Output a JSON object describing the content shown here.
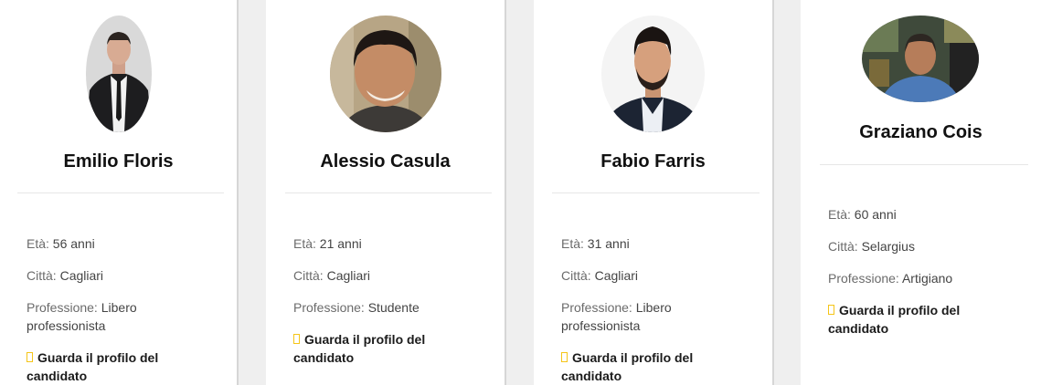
{
  "labels": {
    "age": "Età:",
    "city": "Città:",
    "profession": "Professione:",
    "cta": "Guarda il profilo del candidato"
  },
  "candidates": [
    {
      "name": "Emilio Floris",
      "age": "56 anni",
      "city": "Cagliari",
      "profession": "Libero professionista"
    },
    {
      "name": "Alessio Casula",
      "age": "21 anni",
      "city": "Cagliari",
      "profession": "Studente"
    },
    {
      "name": "Fabio Farris",
      "age": "31 anni",
      "city": "Cagliari",
      "profession": "Libero professionista"
    },
    {
      "name": "Graziano Cois",
      "age": "60 anni",
      "city": "Selargius",
      "profession": "Artigiano"
    }
  ],
  "colors": {
    "background": "#efefef",
    "card": "#ffffff",
    "link_marker": "#f5c518"
  }
}
